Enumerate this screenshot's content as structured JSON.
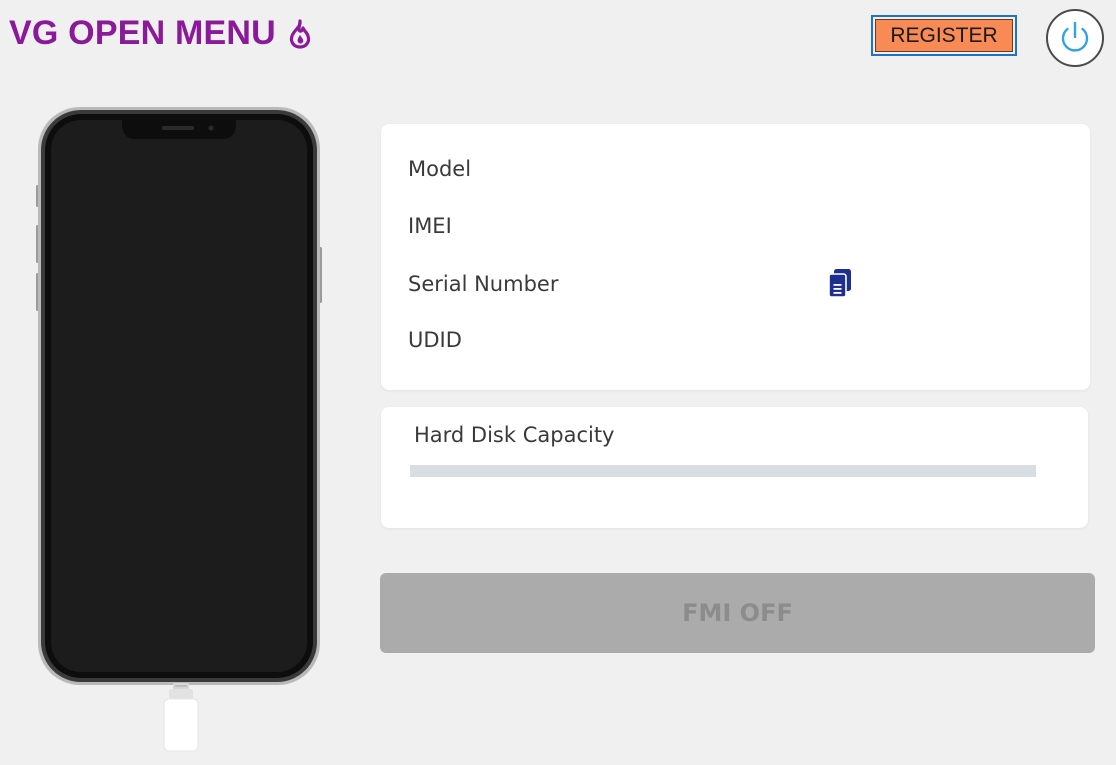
{
  "header": {
    "title": "VG OPEN MENU",
    "title_color": "#8b1a9a",
    "title_icon": "flame-icon",
    "register_label": "REGISTER",
    "register_color": "#f88a55",
    "power_icon": "power-icon"
  },
  "device_info": {
    "labels": {
      "model": "Model",
      "imei": "IMEI",
      "serial": "Serial Number",
      "udid": "UDID"
    },
    "copy_icon": "copy-icon"
  },
  "disk": {
    "label": "Hard Disk Capacity",
    "used_fraction": 0
  },
  "actions": {
    "fmi_off_label": "FMI OFF",
    "fmi_off_enabled": false
  }
}
